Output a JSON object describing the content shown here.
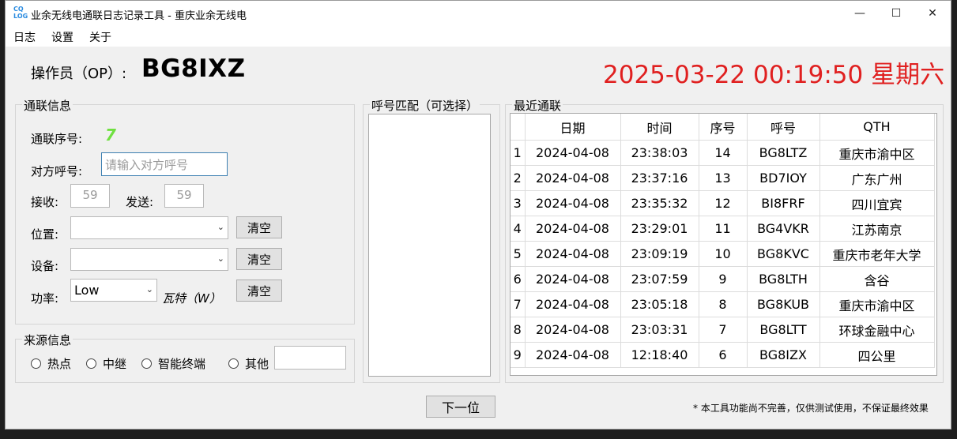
{
  "window": {
    "title": "业余无线电通联日志记录工具 - 重庆业余无线电",
    "icon_text": "CQ LOG",
    "controls": [
      "—",
      "☐",
      "✕"
    ]
  },
  "menu": [
    "日志",
    "设置",
    "关于"
  ],
  "operator": {
    "label": "操作员（OP）:",
    "callsign": "BG8IXZ"
  },
  "clock": "2025-03-22 00:19:50 星期六",
  "contact_info": {
    "title": "通联信息",
    "seq_label": "通联序号:",
    "seq_value": "7",
    "call_label": "对方呼号:",
    "call_placeholder": "请输入对方呼号",
    "rx_label": "接收:",
    "rx_value": "59",
    "tx_label": "发送:",
    "tx_value": "59",
    "location_label": "位置:",
    "location_value": "",
    "equipment_label": "设备:",
    "equipment_value": "",
    "power_label": "功率:",
    "power_value": "Low",
    "power_unit": "瓦特（W）",
    "clear_label": "清空"
  },
  "source_info": {
    "title": "来源信息",
    "options": [
      "热点",
      "中继",
      "智能终端",
      "其他"
    ],
    "other_value": ""
  },
  "callsign_match": {
    "title": "呼号匹配（可选择）"
  },
  "recent": {
    "title": "最近通联",
    "columns": [
      "日期",
      "时间",
      "序号",
      "呼号",
      "QTH"
    ],
    "rows": [
      {
        "n": "1",
        "date": "2024-04-08",
        "time": "23:38:03",
        "seq": "14",
        "call": "BG8LTZ",
        "qth": "重庆市渝中区"
      },
      {
        "n": "2",
        "date": "2024-04-08",
        "time": "23:37:16",
        "seq": "13",
        "call": "BD7IOY",
        "qth": "广东广州"
      },
      {
        "n": "3",
        "date": "2024-04-08",
        "time": "23:35:32",
        "seq": "12",
        "call": "BI8FRF",
        "qth": "四川宜宾"
      },
      {
        "n": "4",
        "date": "2024-04-08",
        "time": "23:29:01",
        "seq": "11",
        "call": "BG4VKR",
        "qth": "江苏南京"
      },
      {
        "n": "5",
        "date": "2024-04-08",
        "time": "23:09:19",
        "seq": "10",
        "call": "BG8KVC",
        "qth": "重庆市老年大学"
      },
      {
        "n": "6",
        "date": "2024-04-08",
        "time": "23:07:59",
        "seq": "9",
        "call": "BG8LTH",
        "qth": "含谷"
      },
      {
        "n": "7",
        "date": "2024-04-08",
        "time": "23:05:18",
        "seq": "8",
        "call": "BG8KUB",
        "qth": "重庆市渝中区"
      },
      {
        "n": "8",
        "date": "2024-04-08",
        "time": "23:03:31",
        "seq": "7",
        "call": "BG8LTT",
        "qth": "环球金融中心"
      },
      {
        "n": "9",
        "date": "2024-04-08",
        "time": "12:18:40",
        "seq": "6",
        "call": "BG8IZX",
        "qth": "四公里"
      }
    ]
  },
  "next_button": "下一位",
  "footer_note": "* 本工具功能尚不完善，仅供测试使用，不保证最终效果",
  "colors": {
    "clock": "#e02020",
    "seq": "#6fe040"
  }
}
